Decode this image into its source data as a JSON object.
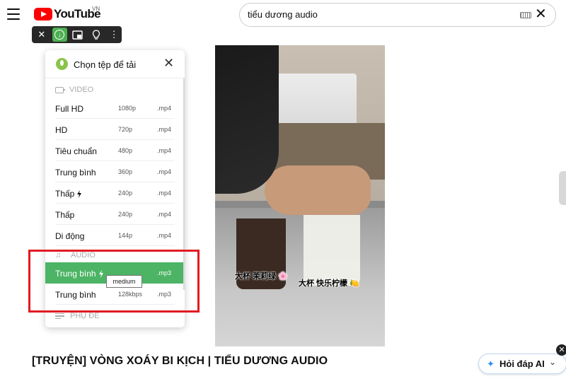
{
  "header": {
    "logo_text": "YouTube",
    "country_code": "VN",
    "search_value": "tiểu dương audio"
  },
  "extension_toolbar": {
    "buttons": [
      "close-icon",
      "download-icon",
      "picture-in-picture-icon",
      "lightbulb-icon",
      "more-icon"
    ],
    "accent": "#4caf50"
  },
  "download_popup": {
    "title": "Chọn tệp để tải",
    "sections": {
      "video": "VIDEO",
      "audio": "AUDIO",
      "subtitle": "PHỤ ĐỀ"
    },
    "video_rows": [
      {
        "label": "Full HD",
        "quality": "1080p",
        "format": ".mp4",
        "fast": false
      },
      {
        "label": "HD",
        "quality": "720p",
        "format": ".mp4",
        "fast": false
      },
      {
        "label": "Tiêu chuẩn",
        "quality": "480p",
        "format": ".mp4",
        "fast": false
      },
      {
        "label": "Trung bình",
        "quality": "360p",
        "format": ".mp4",
        "fast": false
      },
      {
        "label": "Thấp",
        "quality": "240p",
        "format": ".mp4",
        "fast": true
      },
      {
        "label": "Thấp",
        "quality": "240p",
        "format": ".mp4",
        "fast": false
      },
      {
        "label": "Di động",
        "quality": "144p",
        "format": ".mp4",
        "fast": false
      }
    ],
    "audio_rows": [
      {
        "label": "Trung bình",
        "quality": "",
        "format": ".mp3",
        "fast": true,
        "selected": true
      },
      {
        "label": "Trung bình",
        "quality": "128kbps",
        "format": ".mp3",
        "fast": false,
        "selected": false
      }
    ],
    "tooltip": "medium",
    "selected_color": "#4cb464"
  },
  "highlight_color": "#e11b22",
  "video": {
    "caption_left": "大杯 茉莉绿 🌸",
    "caption_right": "大杯 快乐柠檬 🍋"
  },
  "video_title": "[TRUYỆN] VÒNG XOÁY BI KỊCH | TIỂU DƯƠNG AUDIO",
  "ai_button": {
    "label": "Hỏi đáp AI",
    "accent": "#2a8cff"
  }
}
